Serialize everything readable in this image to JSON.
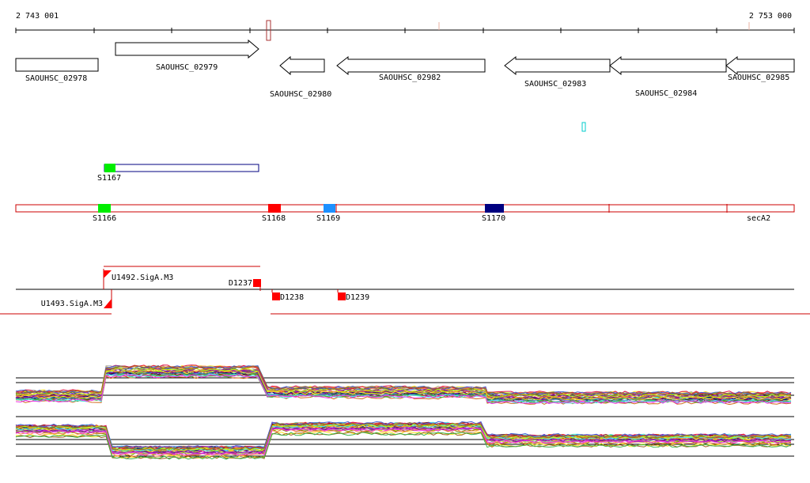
{
  "coordinate_axis": {
    "start_label": "2 743 001",
    "end_label": "2 753 000"
  },
  "genes": [
    {
      "label": "SAOUHSC_02978",
      "strand": "none"
    },
    {
      "label": "SAOUHSC_02979",
      "strand": "+"
    },
    {
      "label": "SAOUHSC_02980",
      "strand": "-"
    },
    {
      "label": "SAOUHSC_02982",
      "strand": "-"
    },
    {
      "label": "SAOUHSC_02983",
      "strand": "-"
    },
    {
      "label": "SAOUHSC_02984",
      "strand": "-"
    },
    {
      "label": "SAOUHSC_02985",
      "strand": "-"
    }
  ],
  "segments_upper": [
    {
      "label": "S1167",
      "color": "#00ee00"
    }
  ],
  "segments_lower": [
    {
      "label": "S1166",
      "color": "#00ee00"
    },
    {
      "label": "S1168",
      "color": "#ff0000"
    },
    {
      "label": "S1169",
      "color": "#1e90ff"
    },
    {
      "label": "S1170",
      "color": "#000080"
    },
    {
      "label": "secA2",
      "color": ""
    }
  ],
  "promoters": [
    {
      "label": "U1492.SigA.M3",
      "strand": "+"
    },
    {
      "label": "U1493.SigA.M3",
      "strand": "-"
    }
  ],
  "terminators": [
    {
      "label": "D1237"
    },
    {
      "label": "D1238"
    },
    {
      "label": "D1239"
    }
  ],
  "colors": {
    "gene_outline": "#000000",
    "segment_outline": "#cc0000",
    "upper_segment_outline": "#000080",
    "marker": "#cc0000",
    "transcript": "#cc0000",
    "tick_highlight": "#e8b0a0",
    "cyan_marker": "#00cccc"
  }
}
